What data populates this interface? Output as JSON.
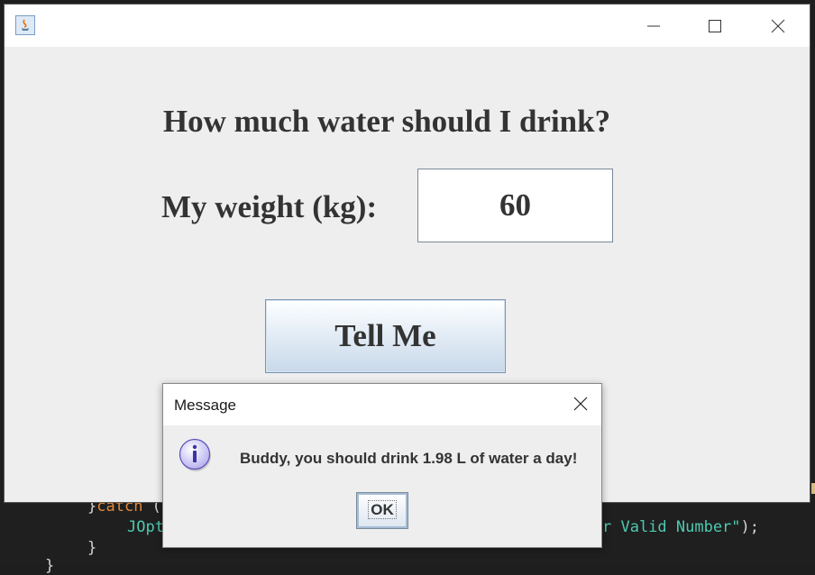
{
  "editor": {
    "line1_brace": "}",
    "line1_keyword": "catch",
    "line1_rest": " (",
    "line2_class": "JOpt",
    "line2_string": "r Valid Number\"",
    "line2_end": ");",
    "line3": "}",
    "line4": "}"
  },
  "window": {
    "heading": "How much water should I drink?",
    "weight_label": "My weight (kg):",
    "weight_value": "60",
    "tell_button": "Tell Me"
  },
  "dialog": {
    "title": "Message",
    "message": "Buddy, you should drink 1.98 L of water a day!",
    "ok_label": "OK",
    "icon": "info-icon"
  }
}
